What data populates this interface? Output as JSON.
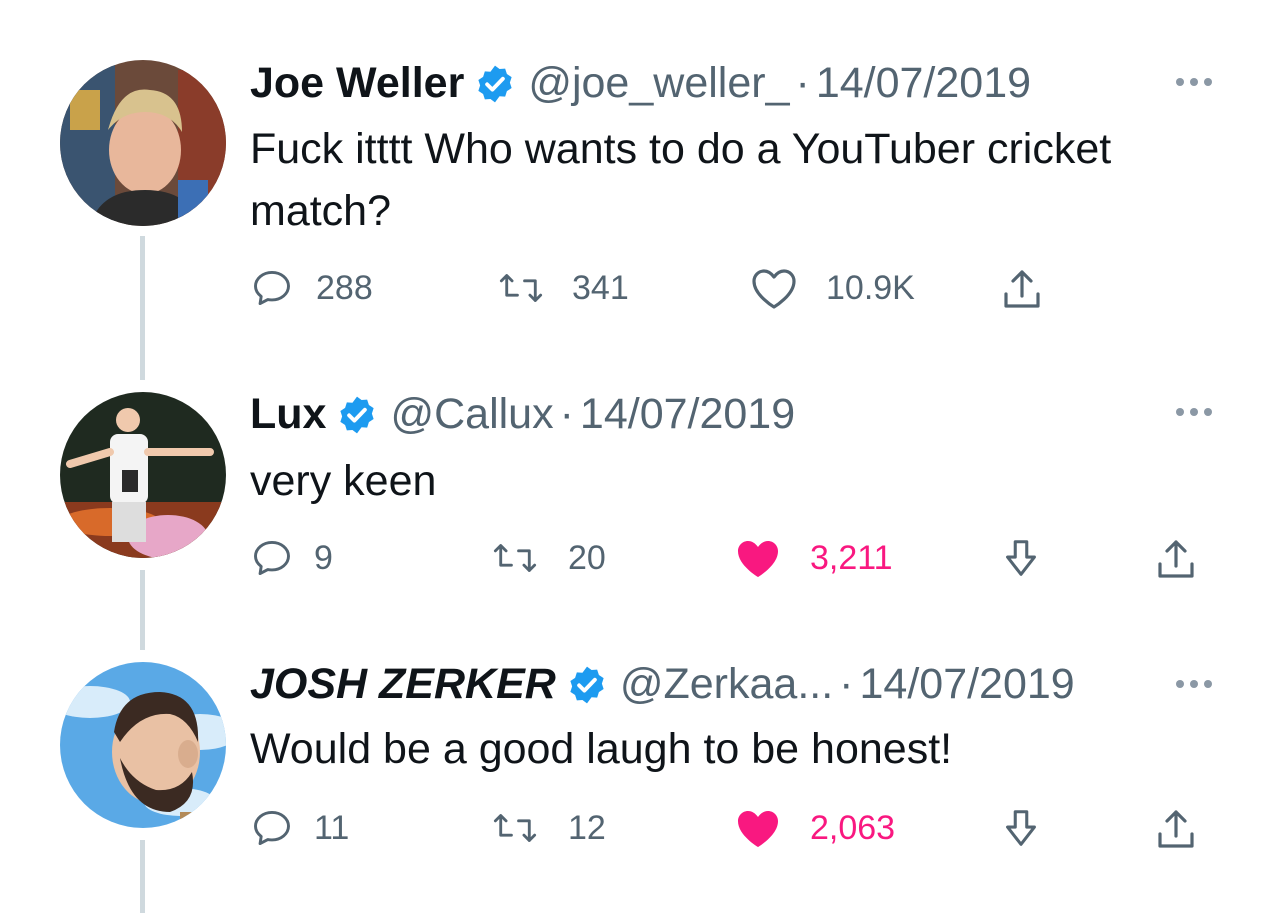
{
  "tweets": [
    {
      "name": "Joe Weller",
      "handle": "@joe_weller_",
      "separator": "·",
      "date": "14/07/2019",
      "text": "Fuck itttt Who wants to do a YouTuber cricket match?",
      "replies": "288",
      "retweets": "341",
      "likes": "10.9K",
      "liked": false,
      "avatar_colors": {
        "bg": "#6b4a3a",
        "skin": "#e8b79b",
        "hair": "#d8c28e",
        "shirt": "#2b2b2b"
      }
    },
    {
      "name": "Lux",
      "handle": "@Callux",
      "separator": "·",
      "date": "14/07/2019",
      "text": "very keen",
      "replies": "9",
      "retweets": "20",
      "likes": "3,211",
      "liked": true,
      "avatar_colors": {
        "bg": "#1f2a20",
        "skin": "#f0c9ad",
        "shirt": "#f4f4f4"
      }
    },
    {
      "name": "JOSH ZERKER",
      "handle": "@Zerkaa...",
      "separator": "·",
      "date": "14/07/2019",
      "text": "Would be a good laugh to be honest!",
      "replies": "11",
      "retweets": "12",
      "likes": "2,063",
      "liked": true,
      "avatar_colors": {
        "bg": "#5aa9e6",
        "skin": "#e9c1a4",
        "beard": "#3b2a22"
      }
    }
  ],
  "colors": {
    "verified": "#1d9bf0",
    "muted_text": "#536471",
    "like_active": "#f91880",
    "thread_line": "#cfd9de"
  },
  "icons": [
    "reply-icon",
    "retweet-icon",
    "like-icon",
    "bookmark-icon",
    "share-icon",
    "verified-badge-icon",
    "more-icon"
  ]
}
